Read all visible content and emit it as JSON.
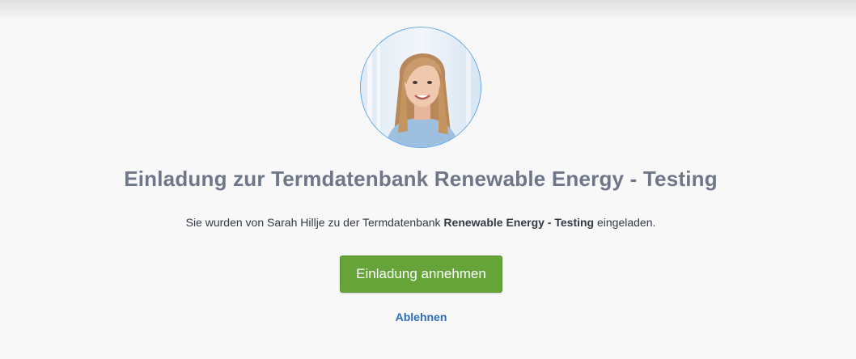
{
  "invitation": {
    "title": "Einladung zur Termdatenbank Renewable Energy - Testing",
    "message_prefix": "Sie wurden von Sarah Hillje zu der Termdatenbank ",
    "database_name": "Renewable Energy - Testing",
    "message_suffix": " eingeladen.",
    "accept_label": "Einladung annehmen",
    "decline_label": "Ablehnen",
    "avatar_icon": "user-photo"
  },
  "colors": {
    "accent_green": "#66a43a",
    "link_blue": "#2e6db5",
    "title_gray": "#6e7687",
    "avatar_border": "#5ea6e6"
  }
}
